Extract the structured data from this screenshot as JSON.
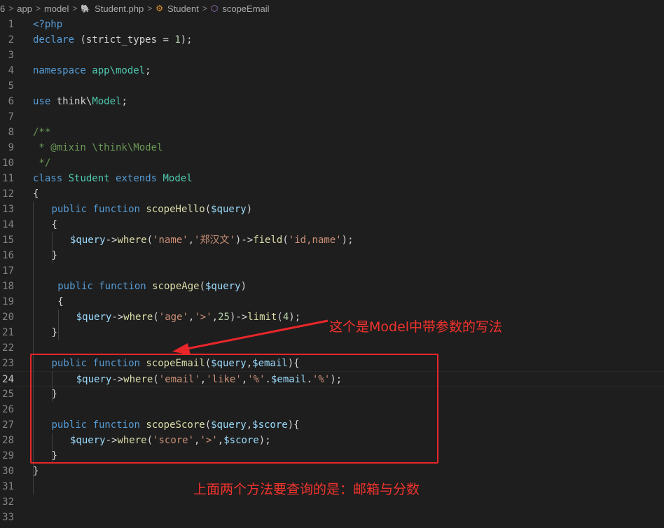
{
  "breadcrumb": {
    "items": [
      "6",
      "app",
      "model",
      "Student.php",
      "Student",
      "scopeEmail"
    ],
    "separator": ">"
  },
  "editor": {
    "line_numbers": [
      "1",
      "2",
      "3",
      "4",
      "5",
      "6",
      "7",
      "8",
      "9",
      "10",
      "11",
      "12",
      "13",
      "14",
      "15",
      "16",
      "17",
      "18",
      "19",
      "20",
      "21",
      "22",
      "23",
      "24",
      "25",
      "26",
      "27",
      "28",
      "29",
      "30",
      "31",
      "32",
      "33"
    ],
    "current_line": "24"
  },
  "annotations": {
    "arrow_text": "这个是Model中带参数的写法",
    "bottom_text": "上面两个方法要查询的是：邮箱与分数"
  },
  "colors": {
    "annotation": "#f0332d",
    "box": "#e8262a",
    "keyword": "#569cd6",
    "function": "#dcdcaa",
    "class": "#4ec9b0",
    "variable": "#9cdcfe",
    "string": "#ce9178",
    "comment": "#6a9955"
  },
  "code_lines": [
    {
      "indent": 0,
      "tokens": [
        {
          "t": "<?php",
          "c": "kw"
        }
      ]
    },
    {
      "indent": 0,
      "tokens": [
        {
          "t": "declare",
          "c": "kw"
        },
        {
          "t": " (strict_types = ",
          "c": "pun"
        },
        {
          "t": "1",
          "c": "num"
        },
        {
          "t": ");",
          "c": "pun"
        }
      ]
    },
    {
      "indent": 0,
      "tokens": []
    },
    {
      "indent": 0,
      "tokens": [
        {
          "t": "namespace",
          "c": "kw"
        },
        {
          "t": " app\\model",
          "c": "cls"
        },
        {
          "t": ";",
          "c": "pun"
        }
      ]
    },
    {
      "indent": 0,
      "tokens": []
    },
    {
      "indent": 0,
      "tokens": [
        {
          "t": "use",
          "c": "kw"
        },
        {
          "t": " think\\",
          "c": "pun"
        },
        {
          "t": "Model",
          "c": "cls"
        },
        {
          "t": ";",
          "c": "pun"
        }
      ]
    },
    {
      "indent": 0,
      "tokens": []
    },
    {
      "indent": 0,
      "tokens": [
        {
          "t": "/**",
          "c": "cmt"
        }
      ]
    },
    {
      "indent": 0,
      "tokens": [
        {
          "t": " * @mixin \\think\\Model",
          "c": "cmt"
        }
      ]
    },
    {
      "indent": 0,
      "tokens": [
        {
          "t": " */",
          "c": "cmt"
        }
      ]
    },
    {
      "indent": 0,
      "tokens": [
        {
          "t": "class",
          "c": "kw"
        },
        {
          "t": " ",
          "c": "pun"
        },
        {
          "t": "Student",
          "c": "cls"
        },
        {
          "t": " ",
          "c": "pun"
        },
        {
          "t": "extends",
          "c": "kw"
        },
        {
          "t": " ",
          "c": "pun"
        },
        {
          "t": "Model",
          "c": "cls"
        }
      ]
    },
    {
      "indent": 0,
      "tokens": [
        {
          "t": "{",
          "c": "pun"
        }
      ]
    },
    {
      "indent": 1,
      "tokens": [
        {
          "t": "public",
          "c": "kw"
        },
        {
          "t": " ",
          "c": "pun"
        },
        {
          "t": "function",
          "c": "kw"
        },
        {
          "t": " ",
          "c": "pun"
        },
        {
          "t": "scopeHello",
          "c": "fn"
        },
        {
          "t": "(",
          "c": "pun"
        },
        {
          "t": "$query",
          "c": "var"
        },
        {
          "t": ")",
          "c": "pun"
        }
      ]
    },
    {
      "indent": 1,
      "tokens": [
        {
          "t": "{",
          "c": "pun"
        }
      ]
    },
    {
      "indent": 2,
      "tokens": [
        {
          "t": "$query",
          "c": "var"
        },
        {
          "t": "->",
          "c": "pun"
        },
        {
          "t": "where",
          "c": "fn"
        },
        {
          "t": "(",
          "c": "pun"
        },
        {
          "t": "'name'",
          "c": "str"
        },
        {
          "t": ",",
          "c": "pun"
        },
        {
          "t": "'郑汉文'",
          "c": "str"
        },
        {
          "t": ")->",
          "c": "pun"
        },
        {
          "t": "field",
          "c": "fn"
        },
        {
          "t": "(",
          "c": "pun"
        },
        {
          "t": "'id,name'",
          "c": "str"
        },
        {
          "t": ");",
          "c": "pun"
        }
      ]
    },
    {
      "indent": 1,
      "tokens": [
        {
          "t": "}",
          "c": "pun"
        }
      ]
    },
    {
      "indent": 0,
      "tokens": []
    },
    {
      "indent": 1.33,
      "tokens": [
        {
          "t": "public",
          "c": "kw"
        },
        {
          "t": " ",
          "c": "pun"
        },
        {
          "t": "function",
          "c": "kw"
        },
        {
          "t": " ",
          "c": "pun"
        },
        {
          "t": "scopeAge",
          "c": "fn"
        },
        {
          "t": "(",
          "c": "pun"
        },
        {
          "t": "$query",
          "c": "var"
        },
        {
          "t": ")",
          "c": "pun"
        }
      ]
    },
    {
      "indent": 1.33,
      "tokens": [
        {
          "t": "{",
          "c": "pun"
        }
      ]
    },
    {
      "indent": 2.33,
      "tokens": [
        {
          "t": "$query",
          "c": "var"
        },
        {
          "t": "->",
          "c": "pun"
        },
        {
          "t": "where",
          "c": "fn"
        },
        {
          "t": "(",
          "c": "pun"
        },
        {
          "t": "'age'",
          "c": "str"
        },
        {
          "t": ",",
          "c": "pun"
        },
        {
          "t": "'>'",
          "c": "str"
        },
        {
          "t": ",",
          "c": "pun"
        },
        {
          "t": "25",
          "c": "num"
        },
        {
          "t": ")->",
          "c": "pun"
        },
        {
          "t": "limit",
          "c": "fn"
        },
        {
          "t": "(",
          "c": "pun"
        },
        {
          "t": "4",
          "c": "num"
        },
        {
          "t": ");",
          "c": "pun"
        }
      ]
    },
    {
      "indent": 1,
      "tokens": [
        {
          "t": "}",
          "c": "pun"
        }
      ]
    },
    {
      "indent": 0,
      "tokens": []
    },
    {
      "indent": 1,
      "tokens": [
        {
          "t": "public",
          "c": "kw"
        },
        {
          "t": " ",
          "c": "pun"
        },
        {
          "t": "function",
          "c": "kw"
        },
        {
          "t": " ",
          "c": "pun"
        },
        {
          "t": "scopeEmail",
          "c": "fn"
        },
        {
          "t": "(",
          "c": "pun"
        },
        {
          "t": "$query",
          "c": "var"
        },
        {
          "t": ",",
          "c": "pun"
        },
        {
          "t": "$email",
          "c": "var"
        },
        {
          "t": "){",
          "c": "pun"
        }
      ]
    },
    {
      "indent": 2.33,
      "tokens": [
        {
          "t": "$query",
          "c": "var"
        },
        {
          "t": "->",
          "c": "pun"
        },
        {
          "t": "where",
          "c": "fn"
        },
        {
          "t": "(",
          "c": "pun"
        },
        {
          "t": "'email'",
          "c": "str"
        },
        {
          "t": ",",
          "c": "pun"
        },
        {
          "t": "'like'",
          "c": "str"
        },
        {
          "t": ",",
          "c": "pun"
        },
        {
          "t": "'%'",
          "c": "str"
        },
        {
          "t": ".",
          "c": "pun"
        },
        {
          "t": "$email",
          "c": "var"
        },
        {
          "t": ".",
          "c": "pun"
        },
        {
          "t": "'%'",
          "c": "str"
        },
        {
          "t": ");",
          "c": "pun"
        }
      ]
    },
    {
      "indent": 1,
      "tokens": [
        {
          "t": "}",
          "c": "pun"
        }
      ]
    },
    {
      "indent": 0,
      "tokens": []
    },
    {
      "indent": 1,
      "tokens": [
        {
          "t": "public",
          "c": "kw"
        },
        {
          "t": " ",
          "c": "pun"
        },
        {
          "t": "function",
          "c": "kw"
        },
        {
          "t": " ",
          "c": "pun"
        },
        {
          "t": "scopeScore",
          "c": "fn"
        },
        {
          "t": "(",
          "c": "pun"
        },
        {
          "t": "$query",
          "c": "var"
        },
        {
          "t": ",",
          "c": "pun"
        },
        {
          "t": "$score",
          "c": "var"
        },
        {
          "t": "){",
          "c": "pun"
        }
      ]
    },
    {
      "indent": 2,
      "tokens": [
        {
          "t": "$query",
          "c": "var"
        },
        {
          "t": "->",
          "c": "pun"
        },
        {
          "t": "where",
          "c": "fn"
        },
        {
          "t": "(",
          "c": "pun"
        },
        {
          "t": "'score'",
          "c": "str"
        },
        {
          "t": ",",
          "c": "pun"
        },
        {
          "t": "'>'",
          "c": "str"
        },
        {
          "t": ",",
          "c": "pun"
        },
        {
          "t": "$score",
          "c": "var"
        },
        {
          "t": ");",
          "c": "pun"
        }
      ]
    },
    {
      "indent": 1,
      "tokens": [
        {
          "t": "}",
          "c": "pun"
        }
      ]
    },
    {
      "indent": 0,
      "tokens": [
        {
          "t": "}",
          "c": "pun"
        }
      ]
    },
    {
      "indent": 0,
      "tokens": []
    },
    {
      "indent": 0,
      "tokens": []
    },
    {
      "indent": 0,
      "tokens": []
    }
  ]
}
